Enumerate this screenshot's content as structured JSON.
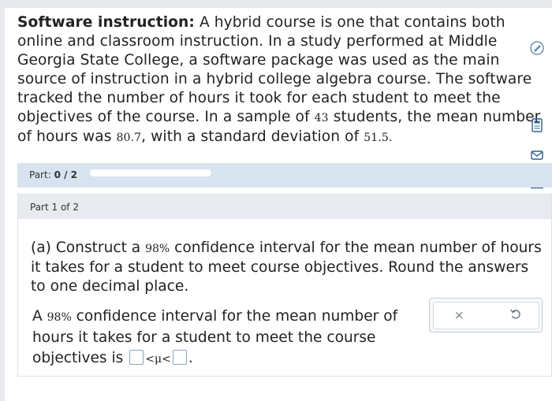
{
  "problem": {
    "title": "Software instruction:",
    "text_1": " A hybrid course is one that contains both online and classroom instruction. In a study performed at Middle Georgia State College, a software package was used as the main source of instruction in a hybrid college algebra course. The software tracked the number of hours it took for each student to meet the objectives of the course. In a sample of ",
    "sample_size": "43",
    "text_2": " students, the mean number of hours was ",
    "mean": "80.7",
    "text_3": ", with a standard deviation of ",
    "std_dev": "51.5",
    "text_4": "."
  },
  "progress": {
    "label": "Part:",
    "value": "0 / 2",
    "fraction": 0
  },
  "part": {
    "label": "Part 1 of 2",
    "question_1": "(a) Construct a ",
    "confidence": "98%",
    "question_2": " confidence interval for the mean number of hours it takes for a student to meet course objectives. Round the answers to one decimal place.",
    "answer_1": "A ",
    "answer_confidence": "98%",
    "answer_2": " confidence interval for the mean number of hours it takes for a student to meet the course objectives is ",
    "inequality": "<μ<",
    "answer_end": "."
  },
  "actions": {
    "clear": "×"
  },
  "icons": [
    "pencil-icon",
    "calculator-icon",
    "mail-icon",
    "bar-chart-icon",
    "data-icon"
  ],
  "colors": {
    "accent": "#d7e3ee",
    "input_border": "#8aa7c4",
    "tool_blue": "#2f5f8f"
  }
}
